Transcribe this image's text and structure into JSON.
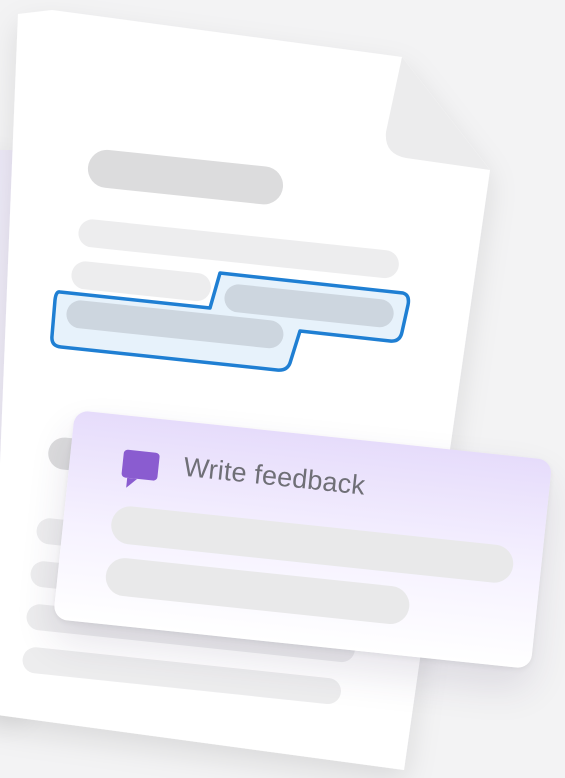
{
  "feedback_card": {
    "title": "Write feedback",
    "icon": "speech-bubble-icon",
    "accent_color": "#8a5cd0"
  },
  "document": {
    "highlight_color": "#1f7fd3",
    "highlight_fill": "#e7f2fb"
  }
}
